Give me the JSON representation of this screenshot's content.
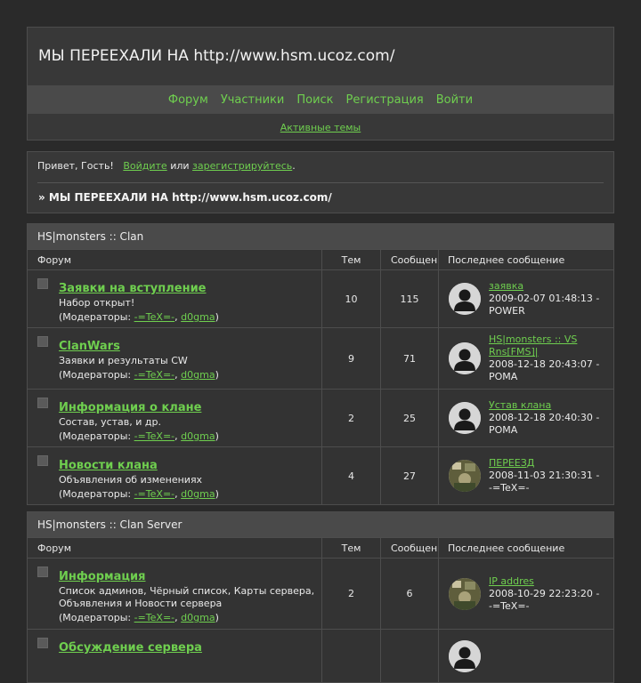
{
  "header": {
    "title": "МЫ ПЕРЕЕХАЛИ НА http://www.hsm.ucoz.com/",
    "nav": [
      "Форум",
      "Участники",
      "Поиск",
      "Регистрация",
      "Войти"
    ],
    "subnav": "Активные темы"
  },
  "welcome": {
    "greeting": "Привет, Гость!",
    "login": "Войдите",
    "or": "или",
    "register": "зарегистрируйтесь",
    "dot": ".",
    "crumb": "» МЫ ПЕРЕЕХАЛИ НА http://www.hsm.ucoz.com/"
  },
  "columns": {
    "forum": "Форум",
    "topics": "Тем",
    "posts": "Сообщений",
    "last": "Последнее сообщение"
  },
  "mods_label": "(Модераторы:",
  "mods_sep": ",",
  "mods_close": ")",
  "categories": [
    {
      "title": "HS|monsters :: Clan",
      "forums": [
        {
          "name": "Заявки на вступление",
          "desc": "Набор открыт!",
          "mods": [
            "-=TeX=-",
            "d0gma"
          ],
          "topics": "10",
          "posts": "115",
          "last": {
            "title": "заявка",
            "date": "2009-02-07 01:48:13 -",
            "user": "POWER",
            "avatar": "default-avatar-icon"
          }
        },
        {
          "name": "ClanWars",
          "desc": "Заявки и результаты CW",
          "mods": [
            "-=TeX=-",
            "d0gma"
          ],
          "topics": "9",
          "posts": "71",
          "last": {
            "title": "HS|monsters :: VS Rns[FMS]|",
            "date": "2008-12-18 20:43:07 -",
            "user": "POMA",
            "avatar": "default-avatar-icon"
          }
        },
        {
          "name": "Информация о клане",
          "desc": "Состав, устав, и др.",
          "mods": [
            "-=TeX=-",
            "d0gma"
          ],
          "topics": "2",
          "posts": "25",
          "last": {
            "title": "Устав клана",
            "date": "2008-12-18 20:40:30 -",
            "user": "POMA",
            "avatar": "default-avatar-icon"
          }
        },
        {
          "name": "Новости клана",
          "desc": "Объявления об изменениях",
          "mods": [
            "-=TeX=-",
            "d0gma"
          ],
          "topics": "4",
          "posts": "27",
          "last": {
            "title": "ПЕРЕЕЗД",
            "date": "2008-11-03 21:30:31 -",
            "user": "-=TeX=-",
            "avatar": "photo-avatar-icon"
          }
        }
      ]
    },
    {
      "title": "HS|monsters :: Clan Server",
      "forums": [
        {
          "name": "Информация",
          "desc": "Список админов, Чёрный список, Карты сервера, Объявления и Новости сервера",
          "mods": [
            "-=TeX=-",
            "d0gma"
          ],
          "topics": "2",
          "posts": "6",
          "last": {
            "title": "IP addres",
            "date": "2008-10-29 22:23:20 -",
            "user": "-=TeX=-",
            "avatar": "photo-avatar-icon"
          }
        },
        {
          "name": "Обсуждение сервера",
          "desc": "",
          "mods": [],
          "topics": "",
          "posts": "",
          "last": {
            "title": "",
            "date": "",
            "user": "",
            "avatar": "default-avatar-icon"
          }
        }
      ]
    }
  ],
  "colors": {
    "accent": "#6fcf4f",
    "background": "#2a2a2a",
    "panel": "#383838",
    "bar": "#4a4a4a"
  }
}
